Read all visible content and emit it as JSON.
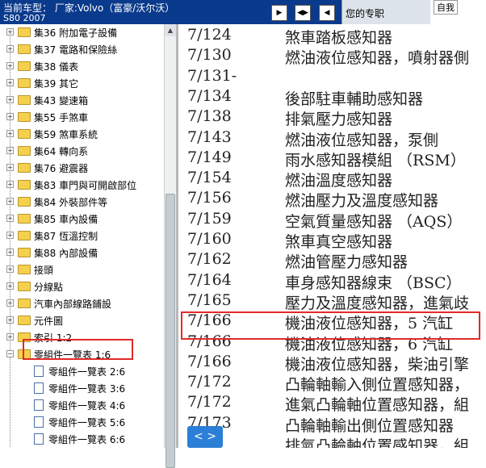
{
  "header": {
    "line1": "当前车型：  厂家:Volvo（富豪/沃尔沃）",
    "line2": "S80 2007"
  },
  "dock_text": "您的专职",
  "mascot_label": "自我",
  "tree": {
    "items": [
      {
        "label": "集36 附加電子設備"
      },
      {
        "label": "集37 電路和保險絲"
      },
      {
        "label": "集38 儀表"
      },
      {
        "label": "集39 其它"
      },
      {
        "label": "集43 變速箱"
      },
      {
        "label": "集55 手煞車"
      },
      {
        "label": "集59 煞車系統"
      },
      {
        "label": "集64 轉向系"
      },
      {
        "label": "集76 避震器"
      },
      {
        "label": "集83 車門與可開啟部位"
      },
      {
        "label": "集84 外裝部件等"
      },
      {
        "label": "集85 車內設備"
      },
      {
        "label": "集87 恆溫控制"
      },
      {
        "label": "集88 內部設備"
      },
      {
        "label": "接頭"
      },
      {
        "label": "分線點"
      },
      {
        "label": "汽車內部線路鋪設"
      },
      {
        "label": "元件圖"
      },
      {
        "label": "索引 1:2"
      },
      {
        "label": "零組件一覽表 1:6"
      }
    ],
    "children": [
      {
        "label": "零組件一覽表 2:6"
      },
      {
        "label": "零組件一覽表 3:6"
      },
      {
        "label": "零組件一覽表 4:6"
      },
      {
        "label": "零組件一覽表 5:6"
      },
      {
        "label": "零組件一覽表 6:6"
      }
    ]
  },
  "components": [
    {
      "code": "7/124",
      "desc": "煞車踏板感知器"
    },
    {
      "code": "7/130",
      "desc": "燃油液位感知器，噴射器側"
    },
    {
      "code": "7/131-",
      "desc": ""
    },
    {
      "code": "7/134",
      "desc": "後部駐車輔助感知器"
    },
    {
      "code": "7/138",
      "desc": "排氣壓力感知器"
    },
    {
      "code": "7/143",
      "desc": "燃油液位感知器，泵側"
    },
    {
      "code": "7/149",
      "desc": "雨水感知器模組 （RSM）"
    },
    {
      "code": "7/154",
      "desc": "燃油溫度感知器"
    },
    {
      "code": "7/156",
      "desc": "燃油壓力及溫度感知器"
    },
    {
      "code": "7/159",
      "desc": "空氣質量感知器 （AQS）"
    },
    {
      "code": "7/160",
      "desc": "煞車真空感知器"
    },
    {
      "code": "7/162",
      "desc": "燃油管壓力感知器"
    },
    {
      "code": "7/164",
      "desc": "車身感知器線束 （BSC）"
    },
    {
      "code": "7/165",
      "desc": "壓力及溫度感知器，進氣歧"
    },
    {
      "code": "7/166",
      "desc": "機油液位感知器，5 汽缸"
    },
    {
      "code": "7/166",
      "desc": "機油液位感知器，6 汽缸"
    },
    {
      "code": "7/166",
      "desc": "機油液位感知器，柴油引擎"
    },
    {
      "code": "7/172",
      "desc": "凸輪軸輸入側位置感知器，"
    },
    {
      "code": "7/172",
      "desc": "進氣凸輪軸位置感知器，組"
    },
    {
      "code": "7/173",
      "desc": "凸輪軸輸出側位置感知器"
    },
    {
      "code": "",
      "desc": "排氣凸輪軸位置感知器，組"
    }
  ],
  "nav_label": "< >"
}
